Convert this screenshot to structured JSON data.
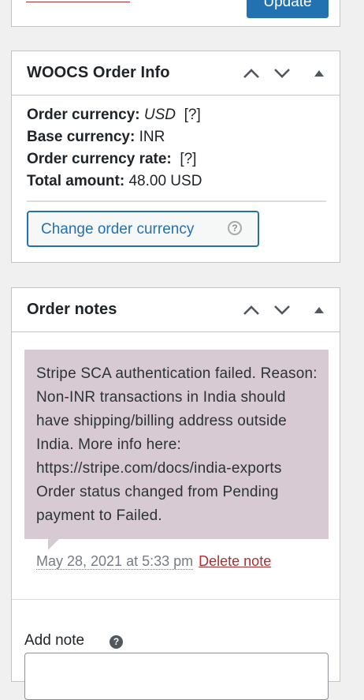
{
  "publish_box": {
    "update_label": "Update"
  },
  "woocs_box": {
    "title": "WOOCS Order Info",
    "rows": [
      {
        "label": "Order currency",
        "value": "USD",
        "help": "[?]"
      },
      {
        "label": "Base currency",
        "value": "INR"
      },
      {
        "label": "Order currency rate",
        "help": "[?]"
      },
      {
        "label": "Total amount",
        "value": "48.00 USD"
      }
    ],
    "change_button_label": "Change order currency",
    "change_button_help_glyph": "?"
  },
  "notes_box": {
    "title": "Order notes",
    "note": {
      "text": "Stripe SCA authentication failed. Reason: Non-INR transactions in India should have shipping/billing address outside India. More info here: https://stripe.com/docs/india-exports Order status changed from Pending payment to Failed.",
      "date": "May 28, 2021 at 5:33 pm",
      "delete_label": "Delete note"
    },
    "add_note_label": "Add note",
    "add_note_help_glyph": "?"
  },
  "icons": {
    "move_up": "chevron-up-icon",
    "move_down": "chevron-down-icon",
    "toggle": "triangle-up-icon"
  },
  "colors": {
    "accent": "#2271b1",
    "danger": "#b32d2e",
    "note_background": "#d7cad2",
    "border": "#c3c4c7"
  }
}
